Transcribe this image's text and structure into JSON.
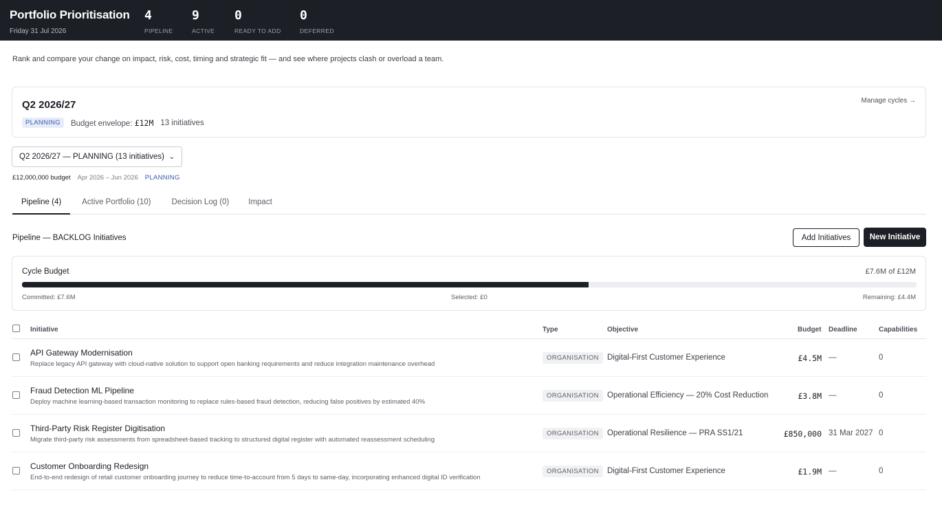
{
  "header": {
    "title": "Portfolio Prioritisation",
    "date": "Friday 31 Jul 2026",
    "stats": [
      {
        "value": "4",
        "label": "PIPELINE"
      },
      {
        "value": "9",
        "label": "ACTIVE"
      },
      {
        "value": "0",
        "label": "READY TO ADD"
      },
      {
        "value": "0",
        "label": "DEFERRED"
      }
    ]
  },
  "intro": "Rank and compare your change on impact, risk, cost, timing and strategic fit — and see where projects clash or overload a team.",
  "cycle": {
    "name": "Q2 2026/27",
    "status": "PLANNING",
    "budget_label": "Budget envelope:",
    "budget_value": "£12M",
    "initiatives": "13 initiatives",
    "manage_link": "Manage cycles →"
  },
  "selector": {
    "value": "Q2 2026/27 — PLANNING (13 initiatives)",
    "budget": "£12,000,000 budget",
    "dates": "Apr 2026 – Jun 2026",
    "status": "PLANNING"
  },
  "tabs": [
    {
      "label": "Pipeline (4)",
      "active": true
    },
    {
      "label": "Active Portfolio (10)",
      "active": false
    },
    {
      "label": "Decision Log (0)",
      "active": false
    },
    {
      "label": "Impact",
      "active": false
    }
  ],
  "section": {
    "title": "Pipeline — BACKLOG Initiatives",
    "add_button": "Add Initiatives",
    "new_button": "New Initiative"
  },
  "budget": {
    "title": "Cycle Budget",
    "summary": "£7.6M of £12M",
    "committed": "Committed: £7.6M",
    "selected": "Selected: £0",
    "remaining": "Remaining: £4.4M",
    "committed_fraction": 0.633
  },
  "table": {
    "headers": {
      "initiative": "Initiative",
      "type": "Type",
      "objective": "Objective",
      "budget": "Budget",
      "deadline": "Deadline",
      "capabilities": "Capabilities"
    },
    "rows": [
      {
        "title": "API Gateway Modernisation",
        "desc": "Replace legacy API gateway with cloud-native solution to support open banking requirements and reduce integration maintenance overhead",
        "type": "ORGANISATION",
        "objective": "Digital-First Customer Experience",
        "budget": "£4.5M",
        "deadline": "—",
        "capabilities": "0"
      },
      {
        "title": "Fraud Detection ML Pipeline",
        "desc": "Deploy machine learning-based transaction monitoring to replace rules-based fraud detection, reducing false positives by estimated 40%",
        "type": "ORGANISATION",
        "objective": "Operational Efficiency — 20% Cost Reduction",
        "budget": "£3.8M",
        "deadline": "—",
        "capabilities": "0"
      },
      {
        "title": "Third-Party Risk Register Digitisation",
        "desc": "Migrate third-party risk assessments from spreadsheet-based tracking to structured digital register with automated reassessment scheduling",
        "type": "ORGANISATION",
        "objective": "Operational Resilience — PRA SS1/21",
        "budget": "£850,000",
        "deadline": "31 Mar 2027",
        "capabilities": "0"
      },
      {
        "title": "Customer Onboarding Redesign",
        "desc": "End-to-end redesign of retail customer onboarding journey to reduce time-to-account from 5 days to same-day, incorporating enhanced digital ID verification",
        "type": "ORGANISATION",
        "objective": "Digital-First Customer Experience",
        "budget": "£1.9M",
        "deadline": "—",
        "capabilities": "0"
      }
    ]
  }
}
